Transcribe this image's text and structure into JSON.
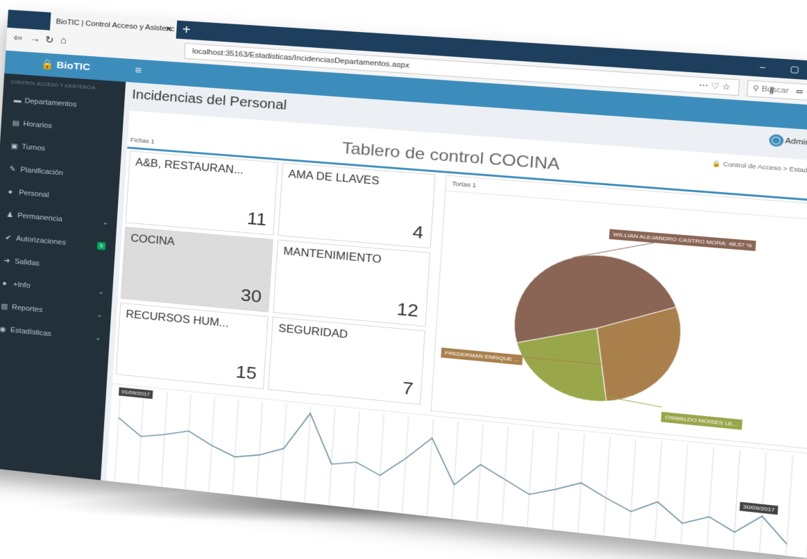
{
  "browser": {
    "tab_title": "BioTIC | Control Acceso y Asistenc",
    "tab_close": "✕",
    "new_tab": "+",
    "url": "localhost:35163/Estadisticas/IncidenciasDepartamentos.aspx",
    "url_actions": "⋯  ♡  ☆",
    "search_placeholder": "Buscar",
    "window_controls": "–  ▢  ✕",
    "toolbar_icons": "⫼ ▭ ≡"
  },
  "sidebar": {
    "brand": "BioTIC",
    "subtitle": "CONTROL ACCESO Y ASISTENCIA",
    "items": [
      {
        "label": "Departamentos",
        "icon": "folder-icon",
        "glyph": "▬"
      },
      {
        "label": "Horarios",
        "icon": "calendar-icon",
        "glyph": "▤"
      },
      {
        "label": "Turnos",
        "icon": "calendar-check-icon",
        "glyph": "▣"
      },
      {
        "label": "Planificación",
        "icon": "edit-icon",
        "glyph": "✎"
      },
      {
        "label": "Personal",
        "icon": "user-icon",
        "glyph": "●"
      },
      {
        "label": "Permanencia",
        "icon": "users-icon",
        "glyph": "♟"
      },
      {
        "label": "Autorizaciones",
        "icon": "check-icon",
        "glyph": "✔"
      },
      {
        "label": "Salidas",
        "icon": "arrow-right-icon",
        "glyph": "➔"
      },
      {
        "label": "+Info",
        "icon": "info-icon",
        "glyph": "●"
      },
      {
        "label": "Reportes",
        "icon": "bar-chart-icon",
        "glyph": "▥"
      },
      {
        "label": "Estadísticas",
        "icon": "chart-icon",
        "glyph": "◉"
      }
    ],
    "badge": "5"
  },
  "header": {
    "page_title": "Incidencias del Personal",
    "user": "Admin",
    "user_icon_glyph": "◯",
    "gear_glyph": "⚙"
  },
  "breadcrumb": "🔒 Control de Acceso  >  Estadísticas",
  "dashboard": {
    "title": "Tablero de control  COCINA",
    "fichas_label": "Fichas 1",
    "tiles": [
      {
        "name": "A&B, RESTAURAN...",
        "value": "11"
      },
      {
        "name": "AMA DE LLAVES",
        "value": "4"
      },
      {
        "name": "COCINA",
        "value": "30"
      },
      {
        "name": "MANTENIMIENTO",
        "value": "12"
      },
      {
        "name": "RECURSOS HUM...",
        "value": "15"
      },
      {
        "name": "SEGURIDAD",
        "value": "7"
      }
    ]
  },
  "pie": {
    "header": "Tortas 1",
    "export_glyph": "⎘",
    "labels": [
      {
        "text": "WILLIAN ALEJANDRO CASTRO MORA: 48,57 %",
        "color": "#8a6555"
      },
      {
        "text": "FREDERMAN ENRIQUE ...",
        "color": "#a9804c"
      },
      {
        "text": "OSWALDO MOISES LE...",
        "color": "#9aa64a"
      }
    ]
  },
  "chart_data": {
    "type": "pie",
    "categories": [
      "WILLIAN ALEJANDRO CASTRO MORA",
      "FREDERMAN ENRIQUE ...",
      "OSWALDO MOISES LE..."
    ],
    "values": [
      48.57,
      28.57,
      22.86
    ],
    "colors": [
      "#8a6555",
      "#a9804c",
      "#9aa64a"
    ]
  },
  "line": {
    "start_date": "01/09/2017",
    "end_date": "30/09/2017",
    "values": [
      4.2,
      3.1,
      3.4,
      3.8,
      3.0,
      2.4,
      2.7,
      3.3,
      5.8,
      2.6,
      2.9,
      2.2,
      3.5,
      5.0,
      2.1,
      3.6,
      2.8,
      2.0,
      2.5,
      3.1,
      2.3,
      1.6,
      2.4,
      1.2,
      1.8,
      1.0,
      2.2,
      0.6
    ]
  }
}
